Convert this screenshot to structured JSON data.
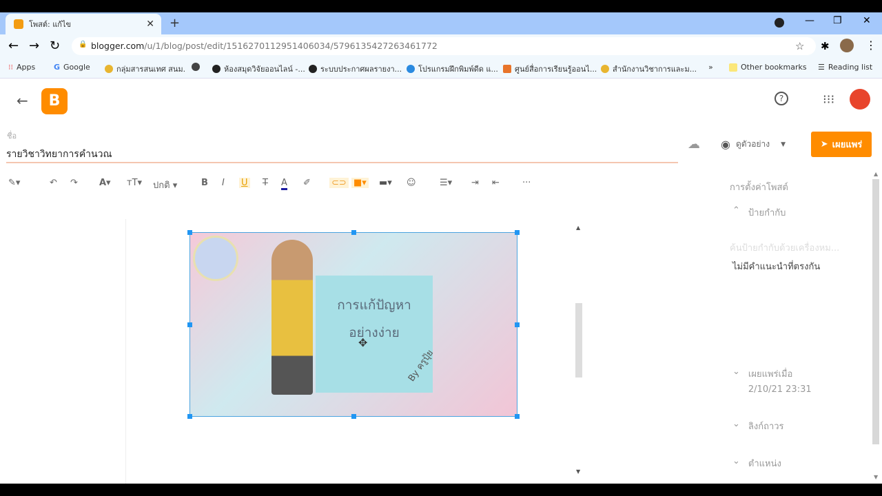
{
  "browser": {
    "tab_title": "โพสต์: แก้ไข",
    "url_host": "blogger.com",
    "url_path": "/u/1/blog/post/edit/1516270112951406034/5796135427263461772",
    "bookmarks": [
      "Apps",
      "Google",
      "กลุ่มสารสนเทศ สนม.",
      "ห้องสมุดวิจัยออนไลน์ -...",
      "ระบบประกาศผลรายงา...",
      "โปรแกรมฝึกพิมพ์ดีด แ...",
      "ศูนย์สื่อการเรียนรู้ออนไ...",
      "สำนักงานวิชาการและม..."
    ],
    "other_bookmarks": "Other bookmarks",
    "reading_list": "Reading list"
  },
  "editor": {
    "title_label": "ชื่อ",
    "title": "รายวิชาวิทยาการคำนวณ",
    "preview": "ดูตัวอย่าง",
    "publish": "เผยแพร่",
    "paragraph_style": "ปกติ",
    "image_text_1": "การแก้ปัญหา",
    "image_text_2": "อย่างง่าย",
    "image_signature": "By ครูปุ้ย"
  },
  "settings": {
    "heading": "การตั้งค่าโพสต์",
    "labels": "ป้ายกำกับ",
    "labels_placeholder": "ค้นป้ายกำกับด้วยเครื่องหม...",
    "no_match": "ไม่มีคำแนะนำที่ตรงกัน",
    "published_on": "เผยแพร่เมื่อ",
    "published_date": "2/10/21 23:31",
    "permalink": "ลิงก์ถาวร",
    "location": "ตำแหน่ง"
  },
  "colors": {
    "accent": "#ff8c00",
    "selection": "#2196f3"
  }
}
